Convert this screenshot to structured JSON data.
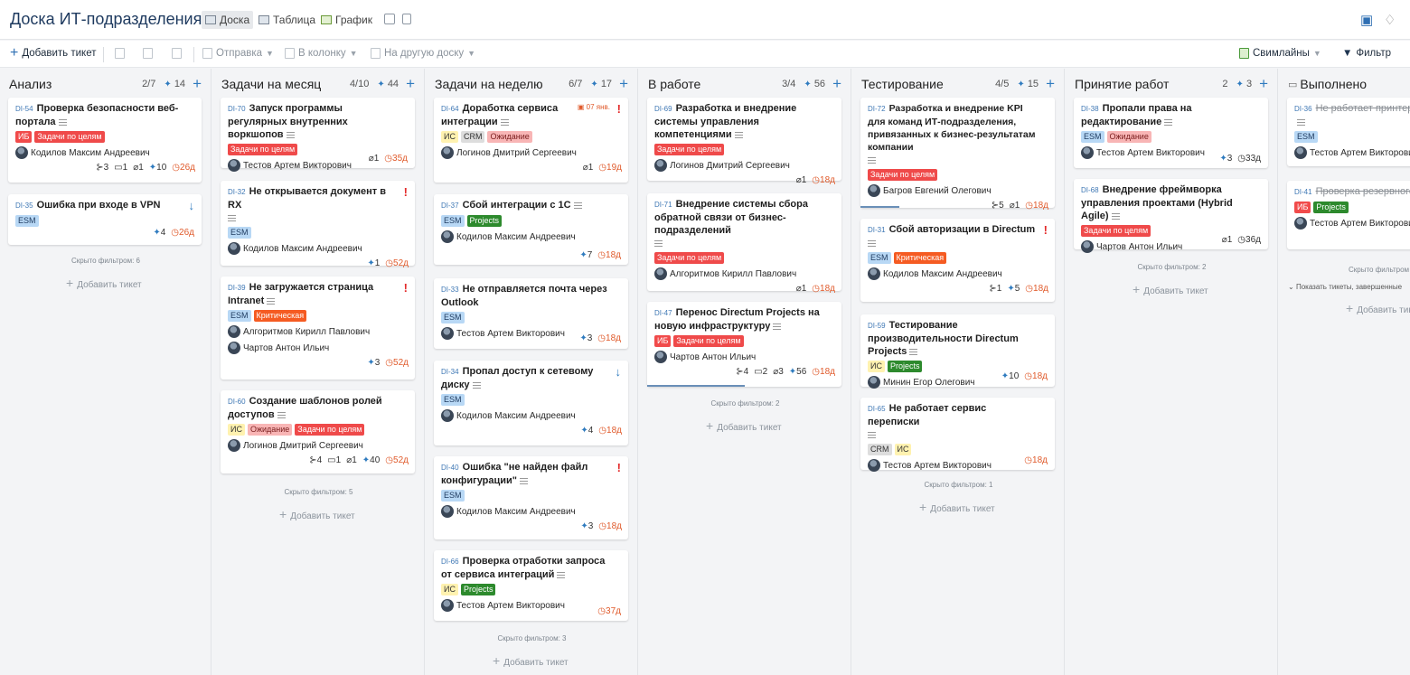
{
  "app": {
    "title": "Доска ИТ-подразделения",
    "views": [
      "Доска",
      "Таблица",
      "График"
    ]
  },
  "toolbar": {
    "add_ticket": "Добавить тикет",
    "send": "Отправка",
    "to_column": "В колонку",
    "to_board": "На другую доску",
    "swimlanes": "Свимлайны",
    "filter": "Фильтр"
  },
  "icons": {
    "add": "plus-icon",
    "filter": "funnel-icon",
    "bell": "bell-icon",
    "notify": "notification-icon",
    "desc": "description-lines-icon",
    "sub": "subtasks-icon",
    "comment": "comment-icon",
    "attach": "paperclip-icon",
    "sp": "story-points-icon",
    "clock": "clock-icon"
  },
  "common": {
    "hidden_prefix": "Скрыто фильтром:",
    "add_ticket": "Добавить тикет",
    "show_done": "Показать тикеты, завершенные"
  },
  "columns": [
    {
      "name": "Анализ",
      "count": "2/7",
      "sp": "14"
    },
    {
      "name": "Задачи на месяц",
      "count": "4/10",
      "sp": "44"
    },
    {
      "name": "Задачи на неделю",
      "count": "6/7",
      "sp": "17"
    },
    {
      "name": "В работе",
      "count": "3/4",
      "sp": "56"
    },
    {
      "name": "Тестирование",
      "count": "4/5",
      "sp": "15"
    },
    {
      "name": "Принятие работ",
      "count": "2",
      "sp": "3"
    },
    {
      "name": "Выполнено",
      "count": "",
      "sp": ""
    }
  ],
  "hidden": {
    "c0": "Скрыто фильтром: 6",
    "c1": "Скрыто фильтром: 5",
    "c2": "Скрыто фильтром: 3",
    "c3": "Скрыто фильтром: 2",
    "c4": "Скрыто фильтром: 1",
    "c5": "Скрыто фильтром: 2",
    "c6": "Скрыто фильтром"
  },
  "cards": {
    "c54": {
      "id": "DI-54",
      "title": "Проверка безопасности веб-портала",
      "tags": [
        "ИБ",
        "Задачи по целям"
      ],
      "person": "Кодилов Максим Андреевич",
      "sub": "3",
      "comm": "1",
      "att": "1",
      "sp": "10",
      "age": "26д"
    },
    "c35": {
      "id": "DI-35",
      "title": "Ошибка при входе в VPN",
      "tags": [
        "ESM"
      ],
      "sp": "4",
      "age": "26д"
    },
    "c70": {
      "id": "DI-70",
      "title": "Запуск программы регулярных внутренних воркшопов",
      "tags": [
        "Задачи по целям"
      ],
      "person": "Тестов Артем Викторович",
      "att": "1",
      "age": "35д"
    },
    "c32": {
      "id": "DI-32",
      "title": "Не открывается документ в RX",
      "tags": [
        "ESM"
      ],
      "person": "Кодилов Максим Андреевич",
      "sp": "1",
      "age": "52д"
    },
    "c39": {
      "id": "DI-39",
      "title": "Не загружается страница Intranet",
      "tags": [
        "ESM",
        "Критическая"
      ],
      "person": "Алгоритмов Кирилл Павлович",
      "person2": "Чартов Антон Ильич",
      "sp": "3",
      "age": "52д"
    },
    "c60": {
      "id": "DI-60",
      "title": "Создание шаблонов ролей доступов",
      "tags": [
        "ИС",
        "Ожидание",
        "Задачи по целям"
      ],
      "person": "Логинов Дмитрий Сергеевич",
      "sub": "4",
      "comm": "1",
      "att": "1",
      "sp": "40",
      "age": "52д"
    },
    "c64": {
      "id": "DI-64",
      "title": "Доработка сервиса интеграции",
      "due": "07 янв.",
      "tags": [
        "ИС",
        "CRM",
        "Ожидание"
      ],
      "person": "Логинов Дмитрий Сергеевич",
      "att": "1",
      "age": "19д"
    },
    "c37": {
      "id": "DI-37",
      "title": "Сбой интеграции с 1С",
      "tags": [
        "ESM",
        "Projects"
      ],
      "person": "Кодилов Максим Андреевич",
      "sp": "7",
      "age": "18д"
    },
    "c33": {
      "id": "DI-33",
      "title": "Не отправляется почта через Outlook",
      "tags": [
        "ESM"
      ],
      "person": "Тестов Артем Викторович",
      "sp": "3",
      "age": "18д"
    },
    "c34": {
      "id": "DI-34",
      "title": "Пропал доступ к сетевому диску",
      "tags": [
        "ESM"
      ],
      "person": "Кодилов Максим Андреевич",
      "sp": "4",
      "age": "18д"
    },
    "c40": {
      "id": "DI-40",
      "title": "Ошибка \"не найден файл конфигурации\"",
      "tags": [
        "ESM"
      ],
      "person": "Кодилов Максим Андреевич",
      "sp": "3",
      "age": "18д"
    },
    "c66": {
      "id": "DI-66",
      "title": "Проверка отработки запроса от сервиса интеграций",
      "tags": [
        "ИС",
        "Projects"
      ],
      "person": "Тестов Артем Викторович",
      "age": "37д"
    },
    "c69": {
      "id": "DI-69",
      "title": "Разработка и внедрение системы управления компетенциями",
      "tags": [
        "Задачи по целям"
      ],
      "person": "Логинов Дмитрий Сергеевич",
      "att": "1",
      "age": "18д"
    },
    "c71": {
      "id": "DI-71",
      "title": "Внедрение системы сбора обратной связи от бизнес-подразделений",
      "tags": [
        "Задачи по целям"
      ],
      "person": "Алгоритмов Кирилл Павлович",
      "att": "1",
      "age": "18д"
    },
    "c47": {
      "id": "DI-47",
      "title": "Перенос Directum Projects на новую инфраструктуру",
      "tags": [
        "ИБ",
        "Задачи по целям"
      ],
      "person": "Чартов Антон Ильич",
      "sub": "4",
      "comm": "2",
      "att": "3",
      "sp": "56",
      "age": "18д"
    },
    "c72": {
      "id": "DI-72",
      "title": "Разработка и внедрение KPI для команд ИТ-подразделения, привязанных к бизнес-результатам компании",
      "tags": [
        "Задачи по целям"
      ],
      "person": "Багров Евгений Олегович",
      "sub": "5",
      "att": "1",
      "age": "18д"
    },
    "c31": {
      "id": "DI-31",
      "title": "Сбой авторизации в Directum",
      "tags": [
        "ESM",
        "Критическая"
      ],
      "person": "Кодилов Максим Андреевич",
      "sub": "1",
      "sp": "5",
      "age": "18д"
    },
    "c59": {
      "id": "DI-59",
      "title": "Тестирование производительности Directum Projects",
      "tags": [
        "ИС",
        "Projects"
      ],
      "person": "Минин Егор Олегович",
      "sp": "10",
      "age": "18д"
    },
    "c65": {
      "id": "DI-65",
      "title": "Не работает сервис переписки",
      "tags": [
        "CRM",
        "ИС"
      ],
      "person": "Тестов Артем Викторович",
      "age": "18д"
    },
    "c38": {
      "id": "DI-38",
      "title": "Пропали права на редактирование",
      "tags": [
        "ESM",
        "Ожидание"
      ],
      "person": "Тестов Артем Викторович",
      "sp": "3",
      "age": "33д"
    },
    "c68": {
      "id": "DI-68",
      "title": "Внедрение фреймворка управления проектами (Hybrid Agile)",
      "tags": [
        "Задачи по целям"
      ],
      "person": "Чартов Антон Ильич",
      "att": "1",
      "age": "36д"
    },
    "c36": {
      "id": "DI-36",
      "title": "Не работает принтер продаж",
      "tags": [
        "ESM"
      ],
      "person": "Тестов Артем Викторович"
    },
    "c41": {
      "id": "DI-41",
      "title": "Проверка резервного ния",
      "tags": [
        "ИБ",
        "Projects"
      ],
      "person": "Тестов Артем Викторович"
    }
  },
  "colors": {
    "accent": "#2f7bbf",
    "late": "#e05a2b",
    "critical": "#e32b2b"
  }
}
